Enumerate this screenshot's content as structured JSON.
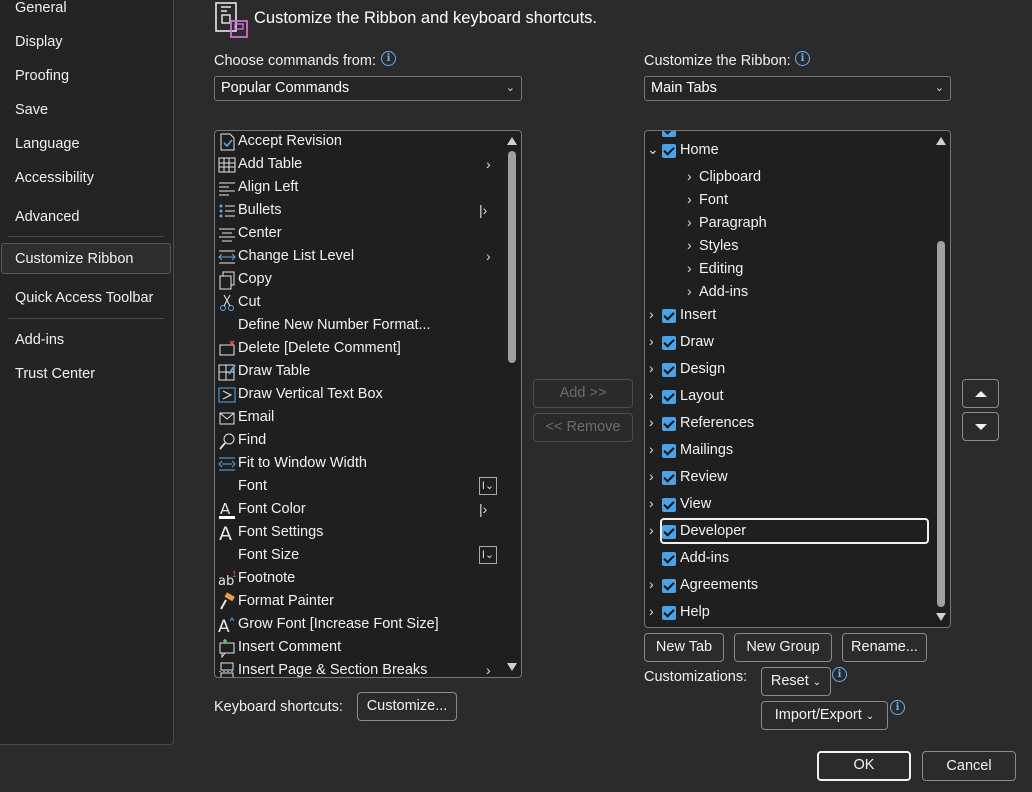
{
  "sidebar": {
    "items": [
      {
        "label": "General"
      },
      {
        "label": "Display"
      },
      {
        "label": "Proofing"
      },
      {
        "label": "Save"
      },
      {
        "label": "Language"
      },
      {
        "label": "Accessibility"
      },
      {
        "label": "Advanced"
      },
      {
        "label": "Customize Ribbon",
        "selected": true
      },
      {
        "label": "Quick Access Toolbar"
      },
      {
        "label": "Add-ins"
      },
      {
        "label": "Trust Center"
      }
    ]
  },
  "header": {
    "title": "Customize the Ribbon and keyboard shortcuts."
  },
  "left": {
    "label": "Choose commands from:",
    "dropdown_value": "Popular Commands",
    "commands": [
      {
        "label": "Accept Revision",
        "icon": "accept-revision-icon",
        "suffix": ""
      },
      {
        "label": "Add Table",
        "icon": "table-icon",
        "suffix": "chevron"
      },
      {
        "label": "Align Left",
        "icon": "align-left-icon",
        "suffix": ""
      },
      {
        "label": "Bullets",
        "icon": "bullets-icon",
        "suffix": "split"
      },
      {
        "label": "Center",
        "icon": "center-icon",
        "suffix": ""
      },
      {
        "label": "Change List Level",
        "icon": "list-level-icon",
        "suffix": "chevron"
      },
      {
        "label": "Copy",
        "icon": "copy-icon",
        "suffix": ""
      },
      {
        "label": "Cut",
        "icon": "scissors-icon",
        "suffix": ""
      },
      {
        "label": "Define New Number Format...",
        "icon": "",
        "suffix": ""
      },
      {
        "label": "Delete [Delete Comment]",
        "icon": "delete-comment-icon",
        "suffix": ""
      },
      {
        "label": "Draw Table",
        "icon": "draw-table-icon",
        "suffix": ""
      },
      {
        "label": "Draw Vertical Text Box",
        "icon": "text-box-icon",
        "suffix": ""
      },
      {
        "label": "Email",
        "icon": "email-icon",
        "suffix": ""
      },
      {
        "label": "Find",
        "icon": "find-icon",
        "suffix": ""
      },
      {
        "label": "Fit to Window Width",
        "icon": "fit-width-icon",
        "suffix": ""
      },
      {
        "label": "Font",
        "icon": "",
        "suffix": "combo"
      },
      {
        "label": "Font Color",
        "icon": "font-color-icon",
        "suffix": "split"
      },
      {
        "label": "Font Settings",
        "icon": "font-settings-icon",
        "suffix": ""
      },
      {
        "label": "Font Size",
        "icon": "",
        "suffix": "combo"
      },
      {
        "label": "Footnote",
        "icon": "footnote-icon",
        "suffix": ""
      },
      {
        "label": "Format Painter",
        "icon": "format-painter-icon",
        "suffix": ""
      },
      {
        "label": "Grow Font [Increase Font Size]",
        "icon": "grow-font-icon",
        "suffix": ""
      },
      {
        "label": "Insert Comment",
        "icon": "insert-comment-icon",
        "suffix": ""
      },
      {
        "label": "Insert Page & Section Breaks",
        "icon": "page-break-icon",
        "suffix": "chevron"
      }
    ]
  },
  "middle": {
    "add_label": "Add >>",
    "remove_label": "<< Remove"
  },
  "right": {
    "label": "Customize the Ribbon:",
    "dropdown_value": "Main Tabs",
    "home_label": "Home",
    "home_groups": [
      "Clipboard",
      "Font",
      "Paragraph",
      "Styles",
      "Editing",
      "Add-ins"
    ],
    "tabs": [
      {
        "label": "Insert",
        "expandable": true
      },
      {
        "label": "Draw",
        "expandable": true
      },
      {
        "label": "Design",
        "expandable": true
      },
      {
        "label": "Layout",
        "expandable": true
      },
      {
        "label": "References",
        "expandable": true
      },
      {
        "label": "Mailings",
        "expandable": true
      },
      {
        "label": "Review",
        "expandable": true
      },
      {
        "label": "View",
        "expandable": true
      },
      {
        "label": "Developer",
        "expandable": true,
        "focused": true
      },
      {
        "label": "Add-ins",
        "expandable": false
      },
      {
        "label": "Agreements",
        "expandable": true
      },
      {
        "label": "Help",
        "expandable": true
      }
    ],
    "new_tab_label": "New Tab",
    "new_group_label": "New Group",
    "rename_label": "Rename...",
    "customizations_label": "Customizations:",
    "reset_label": "Reset",
    "import_export_label": "Import/Export"
  },
  "keyboard": {
    "label": "Keyboard shortcuts:",
    "button_label": "Customize..."
  },
  "footer": {
    "ok_label": "OK",
    "cancel_label": "Cancel"
  },
  "colors": {
    "accent": "#4aa3e8",
    "background": "#2b2b2b",
    "sidebar": "#242424"
  }
}
